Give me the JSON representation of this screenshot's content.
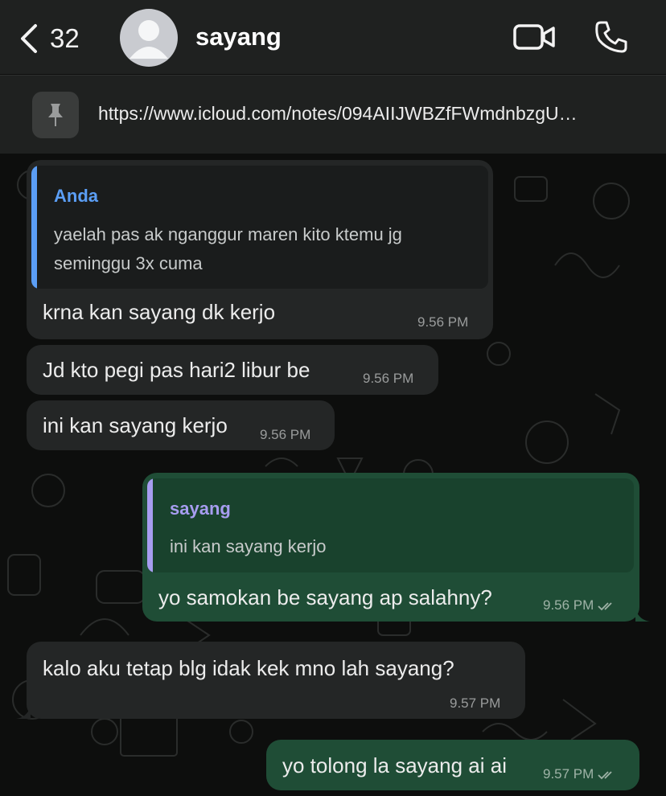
{
  "header": {
    "back_count": "32",
    "contact_name": "sayang"
  },
  "pinned": {
    "text": "https://www.icloud.com/notes/094AIIJWBZfFWmdnbzgU…"
  },
  "colors": {
    "incoming_bubble": "#242626",
    "outgoing_bubble": "#1f4d36",
    "quote_anda_accent": "#5b9ef5",
    "quote_sayang_accent": "#a79df0"
  },
  "messages": [
    {
      "direction": "incoming",
      "quote": {
        "author": "Anda",
        "lines": [
          "yaelah pas ak nganggur maren kito ktemu jg",
          "seminggu 3x cuma"
        ]
      },
      "text": "krna kan sayang dk kerjo",
      "time": "9.56 PM"
    },
    {
      "direction": "incoming",
      "text": "Jd kto pegi pas hari2 libur be",
      "time": "9.56 PM"
    },
    {
      "direction": "incoming",
      "text": "ini kan sayang kerjo",
      "time": "9.56 PM"
    },
    {
      "direction": "outgoing",
      "quote": {
        "author": "sayang",
        "lines": [
          "ini kan sayang kerjo"
        ]
      },
      "text": "yo samokan be sayang ap salahny?",
      "time": "9.56 PM"
    },
    {
      "direction": "incoming",
      "text": "kalo aku tetap blg idak kek mno lah sayang?",
      "time": "9.57 PM"
    },
    {
      "direction": "outgoing",
      "text": "yo tolong la sayang ai ai",
      "time": "9.57 PM"
    }
  ]
}
